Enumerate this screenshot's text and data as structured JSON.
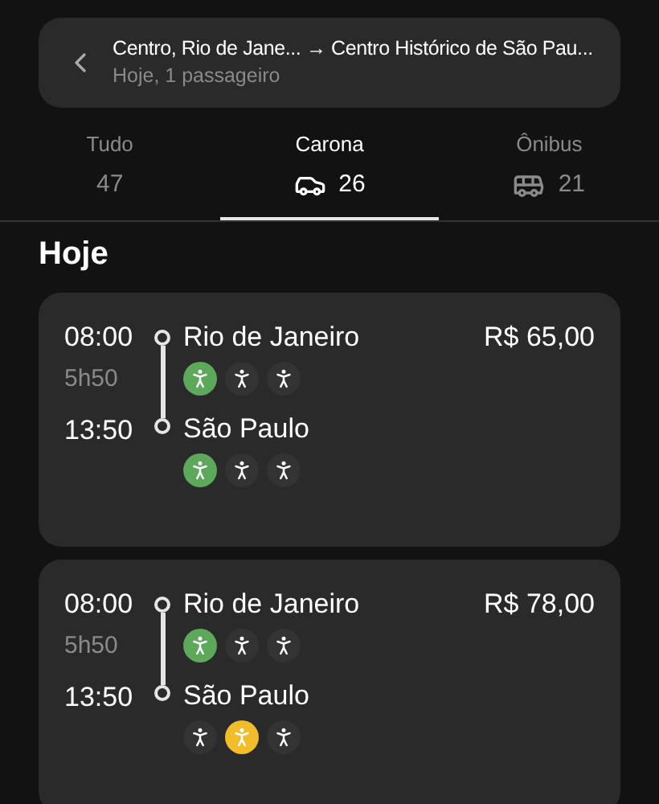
{
  "search": {
    "route": "Centro, Rio de Jane... → Centro Histórico de São Pau...",
    "subtitle": "Hoje, 1 passageiro"
  },
  "tabs": [
    {
      "label": "Tudo",
      "count": "47",
      "kind": "plain",
      "selected": false
    },
    {
      "label": "Carona",
      "count": "26",
      "kind": "car",
      "selected": true
    },
    {
      "label": "Ônibus",
      "count": "21",
      "kind": "bus",
      "selected": false
    }
  ],
  "section_title": "Hoje",
  "trips": [
    {
      "depart_time": "08:00",
      "duration": "5h50",
      "arrive_time": "13:50",
      "origin": "Rio de Janeiro",
      "destination": "São Paulo",
      "price": "R$ 65,00",
      "origin_seats": [
        {
          "color": "#5da85a"
        },
        {
          "color": "#333333"
        },
        {
          "color": "#333333"
        }
      ],
      "destination_seats": [
        {
          "color": "#5da85a"
        },
        {
          "color": "#333333"
        },
        {
          "color": "#333333"
        }
      ]
    },
    {
      "depart_time": "08:00",
      "duration": "5h50",
      "arrive_time": "13:50",
      "origin": "Rio de Janeiro",
      "destination": "São Paulo",
      "price": "R$ 78,00",
      "origin_seats": [
        {
          "color": "#5da85a"
        },
        {
          "color": "#333333"
        },
        {
          "color": "#333333"
        }
      ],
      "destination_seats": [
        {
          "color": "#333333"
        },
        {
          "color": "#f2bd2c"
        },
        {
          "color": "#333333"
        }
      ]
    }
  ]
}
